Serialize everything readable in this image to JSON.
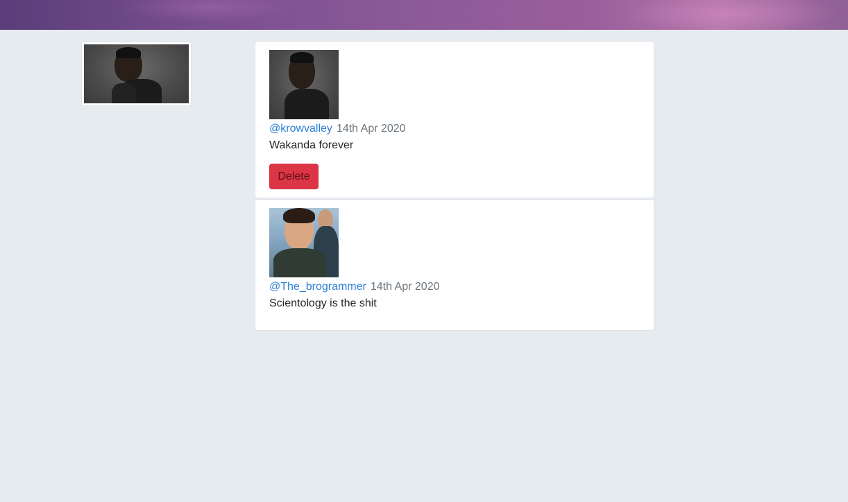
{
  "profile": {
    "avatar_icon": "user-photo"
  },
  "feed": {
    "posts": [
      {
        "handle": "@krowvalley",
        "date": "14th Apr 2020",
        "text": "Wakanda forever",
        "delete_label": "Delete"
      },
      {
        "handle": "@The_brogrammer",
        "date": "14th Apr 2020",
        "text": "Scientology is the shit"
      }
    ]
  }
}
